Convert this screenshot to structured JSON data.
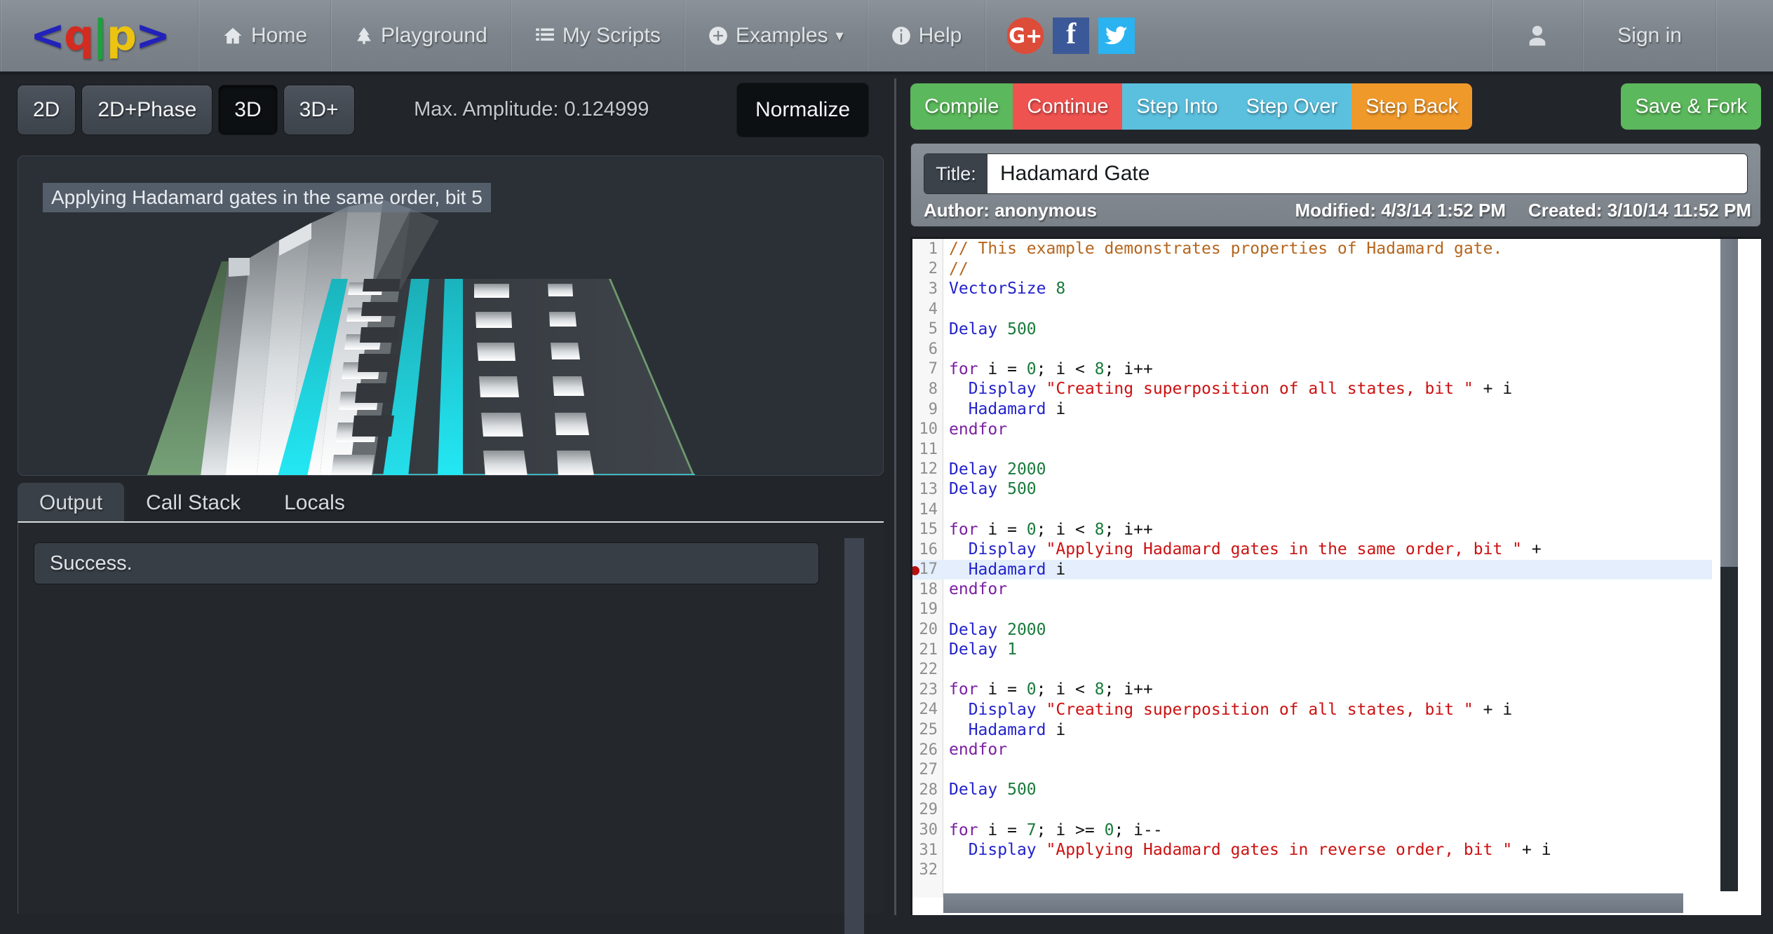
{
  "navbar": {
    "logo": {
      "lt": "<",
      "q": "q",
      "pipe": "|",
      "p": "p",
      "gt": ">"
    },
    "items": [
      {
        "label": "Home",
        "icon": "home-icon"
      },
      {
        "label": "Playground",
        "icon": "tree-icon"
      },
      {
        "label": "My Scripts",
        "icon": "list-icon"
      },
      {
        "label": "Examples",
        "icon": "plus-circle-icon",
        "caret": "▾"
      },
      {
        "label": "Help",
        "icon": "info-icon"
      }
    ],
    "social": [
      {
        "name": "google-plus-icon",
        "label": "G+"
      },
      {
        "name": "facebook-icon",
        "label": "f"
      },
      {
        "name": "twitter-icon",
        "label": ""
      }
    ],
    "user_icon": "user-icon",
    "signin_label": "Sign in"
  },
  "visualization": {
    "view_buttons": [
      {
        "label": "2D",
        "active": false
      },
      {
        "label": "2D+Phase",
        "active": false
      },
      {
        "label": "3D",
        "active": true
      },
      {
        "label": "3D+",
        "active": false
      }
    ],
    "max_amplitude_label": "Max. Amplitude: 0.124999",
    "normalize_label": "Normalize",
    "caption": "Applying Hadamard gates in the same order, bit 5",
    "accent_color": "#19d6e0",
    "floor_color": "#3a3f44",
    "grid_edge_color": "#5f8a5f"
  },
  "output": {
    "tabs": [
      {
        "label": "Output",
        "active": true
      },
      {
        "label": "Call Stack",
        "active": false
      },
      {
        "label": "Locals",
        "active": false
      }
    ],
    "message": "Success."
  },
  "debugger": {
    "buttons": [
      {
        "label": "Compile",
        "color": "#5cb85c"
      },
      {
        "label": "Continue",
        "color": "#ef5350"
      },
      {
        "label": "Step Into",
        "color": "#5bc0de"
      },
      {
        "label": "Step Over",
        "color": "#5bc0de"
      },
      {
        "label": "Step Back",
        "color": "#f0992b"
      }
    ],
    "save_fork_label": "Save & Fork",
    "save_fork_color": "#5cb85c"
  },
  "script": {
    "title_label": "Title:",
    "title_value": "Hadamard Gate",
    "title_placeholder": "Script title",
    "author": "Author: anonymous",
    "modified": "Modified: 4/3/14 1:52 PM",
    "created": "Created: 3/10/14 11:52 PM"
  },
  "code": {
    "active_line": 17,
    "breakpoint_line": 17,
    "lines": [
      {
        "n": 1,
        "tokens": [
          {
            "t": "// This example demonstrates properties of Hadamard gate.",
            "c": "tk-com"
          }
        ]
      },
      {
        "n": 2,
        "tokens": [
          {
            "t": "//",
            "c": "tk-com"
          }
        ]
      },
      {
        "n": 3,
        "tokens": [
          {
            "t": "VectorSize",
            "c": "tk-fn"
          },
          {
            "t": " ",
            "c": "tk-pl"
          },
          {
            "t": "8",
            "c": "tk-num"
          }
        ]
      },
      {
        "n": 4,
        "tokens": []
      },
      {
        "n": 5,
        "tokens": [
          {
            "t": "Delay",
            "c": "tk-fn"
          },
          {
            "t": " ",
            "c": "tk-pl"
          },
          {
            "t": "500",
            "c": "tk-num"
          }
        ]
      },
      {
        "n": 6,
        "tokens": []
      },
      {
        "n": 7,
        "tokens": [
          {
            "t": "for",
            "c": "tk-kw"
          },
          {
            "t": " i = ",
            "c": "tk-pl"
          },
          {
            "t": "0",
            "c": "tk-num"
          },
          {
            "t": "; i < ",
            "c": "tk-pl"
          },
          {
            "t": "8",
            "c": "tk-num"
          },
          {
            "t": "; i++",
            "c": "tk-pl"
          }
        ]
      },
      {
        "n": 8,
        "tokens": [
          {
            "t": "  ",
            "c": "tk-pl"
          },
          {
            "t": "Display",
            "c": "tk-fn"
          },
          {
            "t": " ",
            "c": "tk-pl"
          },
          {
            "t": "\"Creating superposition of all states, bit \"",
            "c": "tk-str"
          },
          {
            "t": " + i",
            "c": "tk-pl"
          }
        ]
      },
      {
        "n": 9,
        "tokens": [
          {
            "t": "  ",
            "c": "tk-pl"
          },
          {
            "t": "Hadamard",
            "c": "tk-fn"
          },
          {
            "t": " i",
            "c": "tk-pl"
          }
        ]
      },
      {
        "n": 10,
        "tokens": [
          {
            "t": "endfor",
            "c": "tk-kw"
          }
        ]
      },
      {
        "n": 11,
        "tokens": []
      },
      {
        "n": 12,
        "tokens": [
          {
            "t": "Delay",
            "c": "tk-fn"
          },
          {
            "t": " ",
            "c": "tk-pl"
          },
          {
            "t": "2000",
            "c": "tk-num"
          }
        ]
      },
      {
        "n": 13,
        "tokens": [
          {
            "t": "Delay",
            "c": "tk-fn"
          },
          {
            "t": " ",
            "c": "tk-pl"
          },
          {
            "t": "500",
            "c": "tk-num"
          }
        ]
      },
      {
        "n": 14,
        "tokens": []
      },
      {
        "n": 15,
        "tokens": [
          {
            "t": "for",
            "c": "tk-kw"
          },
          {
            "t": " i = ",
            "c": "tk-pl"
          },
          {
            "t": "0",
            "c": "tk-num"
          },
          {
            "t": "; i < ",
            "c": "tk-pl"
          },
          {
            "t": "8",
            "c": "tk-num"
          },
          {
            "t": "; i++",
            "c": "tk-pl"
          }
        ]
      },
      {
        "n": 16,
        "tokens": [
          {
            "t": "  ",
            "c": "tk-pl"
          },
          {
            "t": "Display",
            "c": "tk-fn"
          },
          {
            "t": " ",
            "c": "tk-pl"
          },
          {
            "t": "\"Applying Hadamard gates in the same order, bit \"",
            "c": "tk-str"
          },
          {
            "t": " +",
            "c": "tk-pl"
          }
        ]
      },
      {
        "n": 17,
        "tokens": [
          {
            "t": "  ",
            "c": "tk-pl"
          },
          {
            "t": "Hadamard",
            "c": "tk-fn"
          },
          {
            "t": " i",
            "c": "tk-pl"
          }
        ]
      },
      {
        "n": 18,
        "tokens": [
          {
            "t": "endfor",
            "c": "tk-kw"
          }
        ]
      },
      {
        "n": 19,
        "tokens": []
      },
      {
        "n": 20,
        "tokens": [
          {
            "t": "Delay",
            "c": "tk-fn"
          },
          {
            "t": " ",
            "c": "tk-pl"
          },
          {
            "t": "2000",
            "c": "tk-num"
          }
        ]
      },
      {
        "n": 21,
        "tokens": [
          {
            "t": "Delay",
            "c": "tk-fn"
          },
          {
            "t": " ",
            "c": "tk-pl"
          },
          {
            "t": "1",
            "c": "tk-num"
          }
        ]
      },
      {
        "n": 22,
        "tokens": []
      },
      {
        "n": 23,
        "tokens": [
          {
            "t": "for",
            "c": "tk-kw"
          },
          {
            "t": " i = ",
            "c": "tk-pl"
          },
          {
            "t": "0",
            "c": "tk-num"
          },
          {
            "t": "; i < ",
            "c": "tk-pl"
          },
          {
            "t": "8",
            "c": "tk-num"
          },
          {
            "t": "; i++",
            "c": "tk-pl"
          }
        ]
      },
      {
        "n": 24,
        "tokens": [
          {
            "t": "  ",
            "c": "tk-pl"
          },
          {
            "t": "Display",
            "c": "tk-fn"
          },
          {
            "t": " ",
            "c": "tk-pl"
          },
          {
            "t": "\"Creating superposition of all states, bit \"",
            "c": "tk-str"
          },
          {
            "t": " + i",
            "c": "tk-pl"
          }
        ]
      },
      {
        "n": 25,
        "tokens": [
          {
            "t": "  ",
            "c": "tk-pl"
          },
          {
            "t": "Hadamard",
            "c": "tk-fn"
          },
          {
            "t": " i",
            "c": "tk-pl"
          }
        ]
      },
      {
        "n": 26,
        "tokens": [
          {
            "t": "endfor",
            "c": "tk-kw"
          }
        ]
      },
      {
        "n": 27,
        "tokens": []
      },
      {
        "n": 28,
        "tokens": [
          {
            "t": "Delay",
            "c": "tk-fn"
          },
          {
            "t": " ",
            "c": "tk-pl"
          },
          {
            "t": "500",
            "c": "tk-num"
          }
        ]
      },
      {
        "n": 29,
        "tokens": []
      },
      {
        "n": 30,
        "tokens": [
          {
            "t": "for",
            "c": "tk-kw"
          },
          {
            "t": " i = ",
            "c": "tk-pl"
          },
          {
            "t": "7",
            "c": "tk-num"
          },
          {
            "t": "; i >= ",
            "c": "tk-pl"
          },
          {
            "t": "0",
            "c": "tk-num"
          },
          {
            "t": "; i--",
            "c": "tk-pl"
          }
        ]
      },
      {
        "n": 31,
        "tokens": [
          {
            "t": "  ",
            "c": "tk-pl"
          },
          {
            "t": "Display",
            "c": "tk-fn"
          },
          {
            "t": " ",
            "c": "tk-pl"
          },
          {
            "t": "\"Applying Hadamard gates in reverse order, bit \"",
            "c": "tk-str"
          },
          {
            "t": " + i",
            "c": "tk-pl"
          }
        ]
      },
      {
        "n": 32,
        "tokens": []
      }
    ]
  }
}
